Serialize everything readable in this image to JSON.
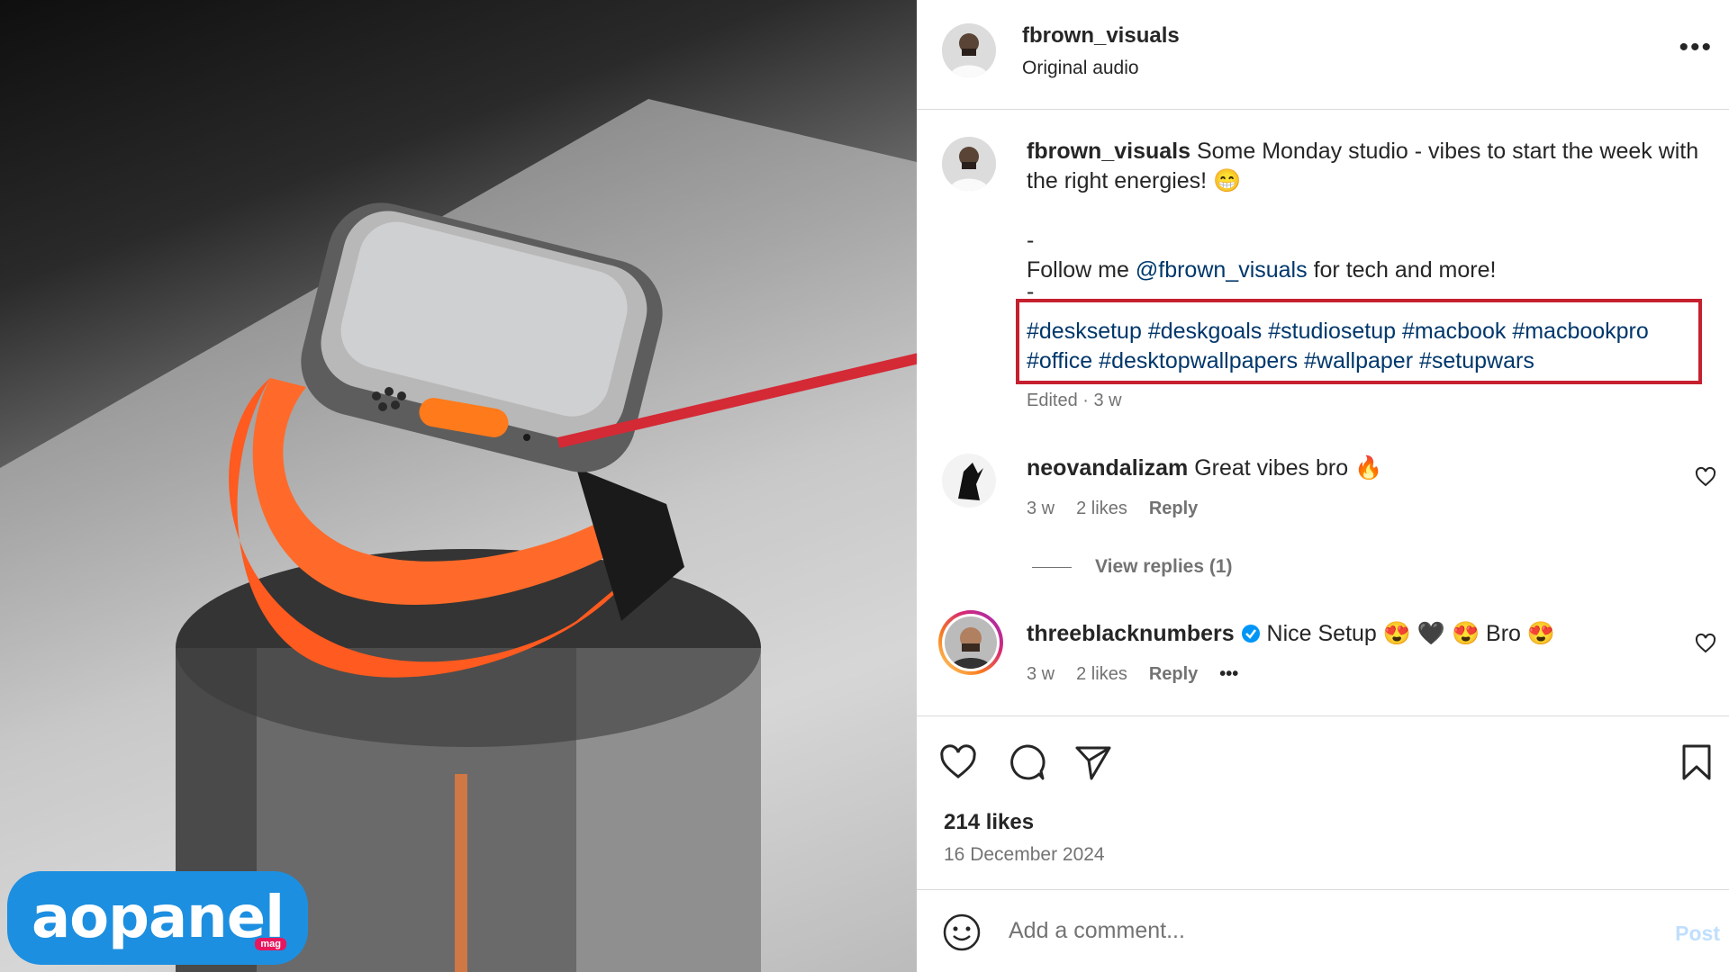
{
  "branding": {
    "logo_text": "aopanel",
    "logo_sub": "mag"
  },
  "post_header": {
    "username": "fbrown_visuals",
    "audio": "Original audio",
    "more_icon": "more-horizontal-icon"
  },
  "caption": {
    "username": "fbrown_visuals",
    "line1": "Some Monday studio - vibes to start the week with the right energies!",
    "emoji": "😁",
    "dash1": "-",
    "follow_prefix": "Follow me",
    "mention": "@fbrown_visuals",
    "follow_suffix": "for tech and more!",
    "dash2": "-",
    "hashtags_line1": [
      "#desksetup",
      "#deskgoals",
      "#studiosetup",
      "#macbook",
      "#macbookpro"
    ],
    "hashtags_line2": [
      "#office",
      "#desktopwallpapers",
      "#wallpaper",
      "#setupwars"
    ],
    "meta": "Edited · 3 w"
  },
  "comments": [
    {
      "username": "neovandalizam",
      "text": "Great vibes bro",
      "emoji": "🔥",
      "time": "3 w",
      "likes": "2 likes",
      "reply": "Reply"
    },
    {
      "username": "threeblacknumbers",
      "verified": true,
      "text": "Nice Setup",
      "emojis_a": "😍 🖤 😍",
      "text2": "Bro",
      "emoji_b": "😍",
      "time": "3 w",
      "likes": "2 likes",
      "reply": "Reply",
      "more": "•••"
    }
  ],
  "view_replies": "View replies (1)",
  "stats": {
    "likes": "214 likes",
    "date": "16 December 2024"
  },
  "composer": {
    "placeholder": "Add a comment...",
    "post_label": "Post"
  },
  "colors": {
    "link": "#00376b",
    "highlight_box": "#c5202e",
    "arrow": "#d42a36",
    "watch_band": "#ff5a1f",
    "logo_bg": "#1d8fe0"
  }
}
